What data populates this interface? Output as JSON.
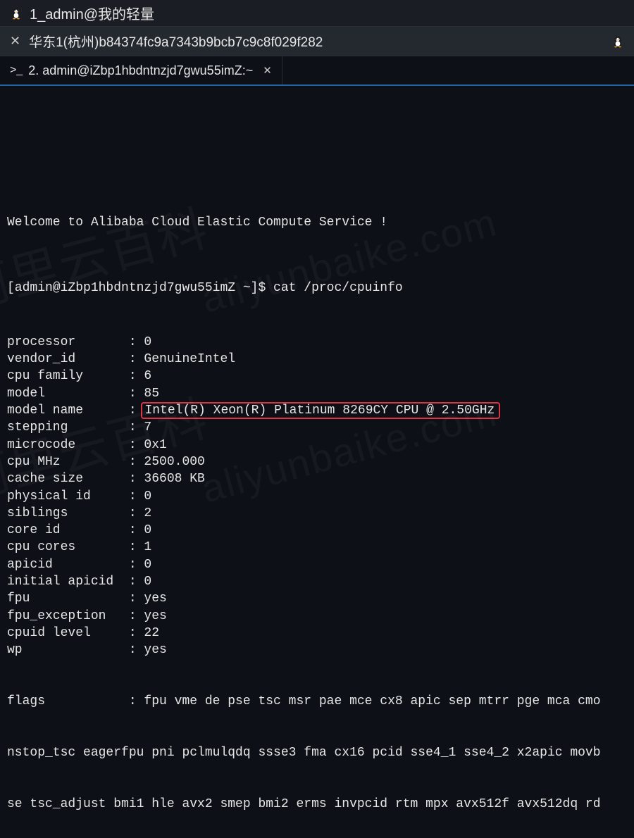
{
  "titleBar": {
    "title": "1_admin@我的轻量"
  },
  "subtitleBar": {
    "text": "华东1(杭州)b84374fc9a7343b9bcb7c9c8f029f282"
  },
  "tab": {
    "prefix": ">_",
    "label": "2. admin@iZbp1hbdntnzjd7gwu55imZ:~",
    "close": "✕"
  },
  "terminal": {
    "welcome": "Welcome to Alibaba Cloud Elastic Compute Service !",
    "prompt": "[admin@iZbp1hbdntnzjd7gwu55imZ ~]$ cat /proc/cpuinfo",
    "rows": [
      {
        "key": "processor",
        "value": "0"
      },
      {
        "key": "vendor_id",
        "value": "GenuineIntel"
      },
      {
        "key": "cpu family",
        "value": "6"
      },
      {
        "key": "model",
        "value": "85"
      },
      {
        "key": "model name",
        "value": "Intel(R) Xeon(R) Platinum 8269CY CPU @ 2.50GHz",
        "highlight": true
      },
      {
        "key": "stepping",
        "value": "7"
      },
      {
        "key": "microcode",
        "value": "0x1"
      },
      {
        "key": "cpu MHz",
        "value": "2500.000"
      },
      {
        "key": "cache size",
        "value": "36608 KB"
      },
      {
        "key": "physical id",
        "value": "0"
      },
      {
        "key": "siblings",
        "value": "2"
      },
      {
        "key": "core id",
        "value": "0"
      },
      {
        "key": "cpu cores",
        "value": "1"
      },
      {
        "key": "apicid",
        "value": "0"
      },
      {
        "key": "initial apicid",
        "value": "0"
      },
      {
        "key": "fpu",
        "value": "yes"
      },
      {
        "key": "fpu_exception",
        "value": "yes"
      },
      {
        "key": "cpuid level",
        "value": "22"
      },
      {
        "key": "wp",
        "value": "yes"
      }
    ],
    "flagsLine1": "flags           : fpu vme de pse tsc msr pae mce cx8 apic sep mtrr pge mca cmo",
    "flagsLine2": "nstop_tsc eagerfpu pni pclmulqdq ssse3 fma cx16 pcid sse4_1 sse4_2 x2apic movb",
    "flagsLine3": "se tsc_adjust bmi1 hle avx2 smep bmi2 erms invpcid rtm mpx avx512f avx512dq rd"
  },
  "watermark": "aliyunbaike.com",
  "watermarkCn": "阿里云百科"
}
